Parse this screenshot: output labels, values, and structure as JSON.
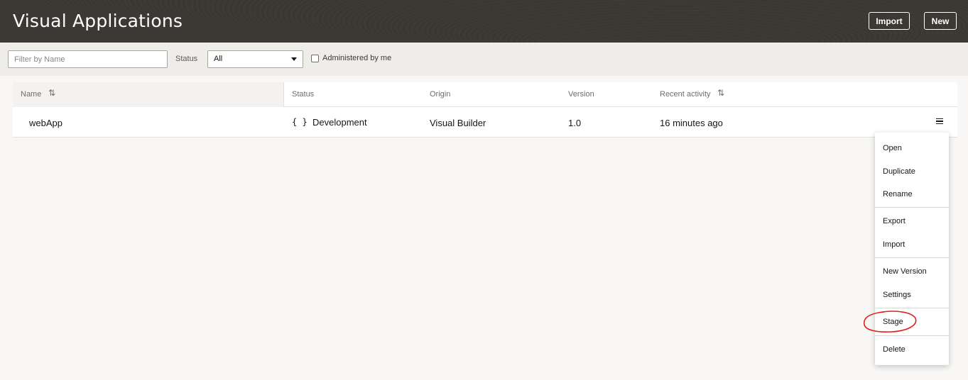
{
  "header": {
    "title": "Visual Applications",
    "import_label": "Import",
    "new_label": "New"
  },
  "filters": {
    "name_placeholder": "Filter by Name",
    "status_label": "Status",
    "status_selected": "All",
    "admin_label": "Administered by me",
    "admin_checked": false
  },
  "table": {
    "columns": [
      "Name",
      "Status",
      "Origin",
      "Version",
      "Recent activity"
    ],
    "rows": [
      {
        "name": "webApp",
        "status_icon": "braces-icon",
        "status": "Development",
        "origin": "Visual Builder",
        "version": "1.0",
        "recent_activity": "16 minutes ago"
      }
    ]
  },
  "menu": {
    "items": [
      "Open",
      "Duplicate",
      "Rename",
      "Export",
      "Import",
      "New Version",
      "Settings",
      "Stage",
      "Delete"
    ],
    "highlighted_item": "Stage",
    "highlight_color": "#e0201b"
  },
  "colors": {
    "header_bg": "#3a3632",
    "page_bg": "#f8f7f5"
  }
}
